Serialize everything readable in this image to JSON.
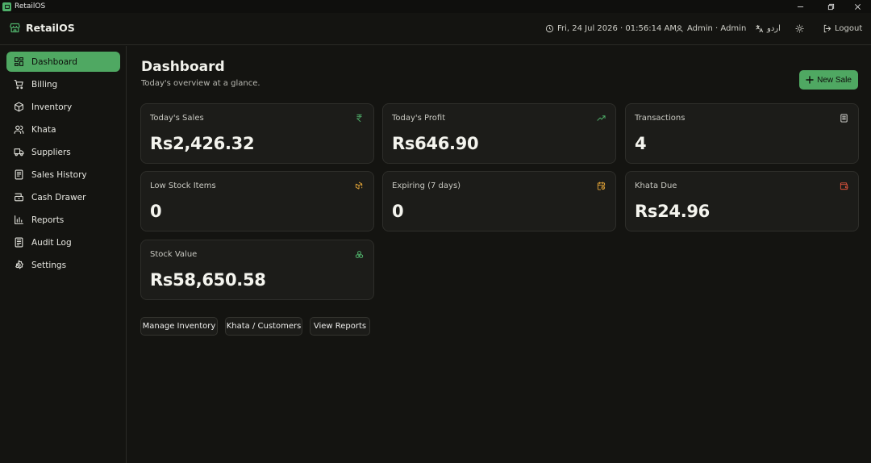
{
  "window": {
    "title": "RetailOS"
  },
  "header": {
    "brand": "RetailOS",
    "datetime": "Fri, 24 Jul 2026 · 01:56:14 AM",
    "user": "Admin · Admin",
    "language": "اردو",
    "logout": "Logout"
  },
  "sidebar": {
    "items": [
      {
        "label": "Dashboard",
        "icon": "layout-grid-icon"
      },
      {
        "label": "Billing",
        "icon": "cart-icon"
      },
      {
        "label": "Inventory",
        "icon": "package-icon"
      },
      {
        "label": "Khata",
        "icon": "users-icon"
      },
      {
        "label": "Suppliers",
        "icon": "truck-icon"
      },
      {
        "label": "Sales History",
        "icon": "receipt-icon"
      },
      {
        "label": "Cash Drawer",
        "icon": "drawer-icon"
      },
      {
        "label": "Reports",
        "icon": "bar-chart-icon"
      },
      {
        "label": "Audit Log",
        "icon": "log-icon"
      },
      {
        "label": "Settings",
        "icon": "gear-icon"
      }
    ]
  },
  "main": {
    "title": "Dashboard",
    "subtitle": "Today's overview at a glance.",
    "new_sale": "New Sale",
    "cards": [
      {
        "label": "Today's Sales",
        "value": "Rs2,426.32",
        "icon": "rupee-icon",
        "color": "#4fb06a"
      },
      {
        "label": "Today's Profit",
        "value": "Rs646.90",
        "icon": "trending-up-icon",
        "color": "#4fb06a"
      },
      {
        "label": "Transactions",
        "value": "4",
        "icon": "receipt-icon",
        "color": "#e8e8e3"
      },
      {
        "label": "Low Stock Items",
        "value": "0",
        "icon": "package-alert-icon",
        "color": "#e8a838"
      },
      {
        "label": "Expiring (7 days)",
        "value": "0",
        "icon": "calendar-clock-icon",
        "color": "#e8a838"
      },
      {
        "label": "Khata Due",
        "value": "Rs24.96",
        "icon": "wallet-icon",
        "color": "#e0533d"
      },
      {
        "label": "Stock Value",
        "value": "Rs58,650.58",
        "icon": "boxes-icon",
        "color": "#4fb06a"
      }
    ],
    "quick_actions": [
      "Manage Inventory",
      "Khata / Customers",
      "View Reports"
    ]
  },
  "colors": {
    "accent": "#4fa862",
    "background": "#141411",
    "card": "#1c1c19"
  }
}
